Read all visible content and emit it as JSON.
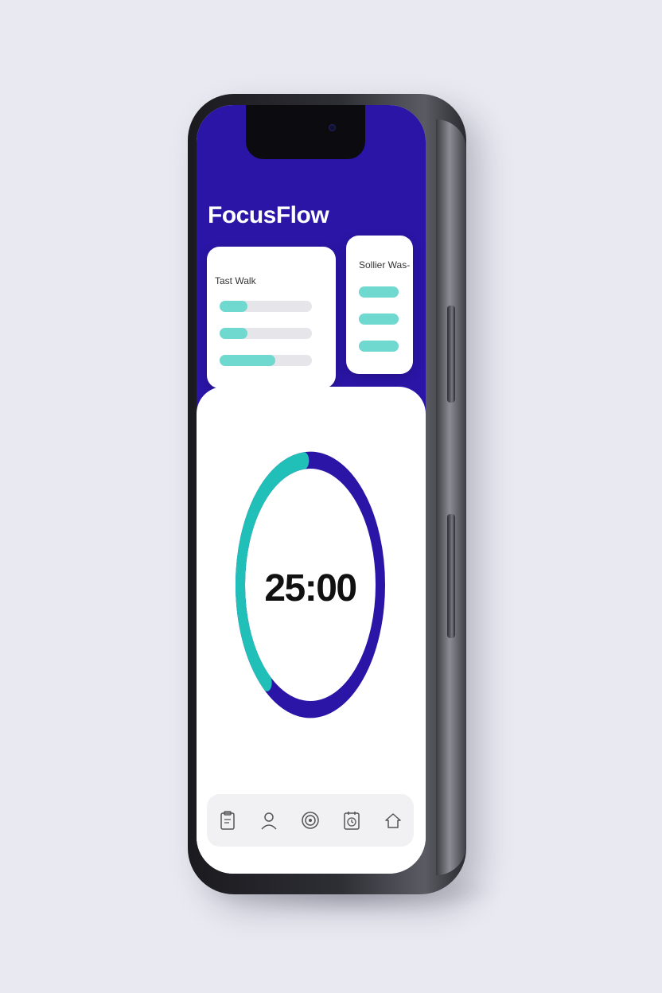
{
  "app": {
    "title": "FocusFlow"
  },
  "colors": {
    "brand_indigo": "#2a15a6",
    "accent_teal": "#20bfb8",
    "progress_teal": "#6fd9d0",
    "track_gray": "#e6e6ea"
  },
  "cards": {
    "main": {
      "title": "Tast Walk",
      "progress": [
        0.3,
        0.3,
        0.6
      ]
    },
    "side": {
      "title": "Sollier Was-",
      "progress": [
        1,
        1,
        1
      ]
    }
  },
  "timer": {
    "display": "25:00",
    "progress_fraction": 0.38
  },
  "nav": {
    "items": [
      {
        "icon": "clipboard-icon",
        "label": ""
      },
      {
        "icon": "user-icon",
        "label": ""
      },
      {
        "icon": "focus-target-icon",
        "label": ""
      },
      {
        "icon": "calendar-clock-icon",
        "label": ""
      },
      {
        "icon": "home-icon",
        "label": ""
      }
    ]
  }
}
